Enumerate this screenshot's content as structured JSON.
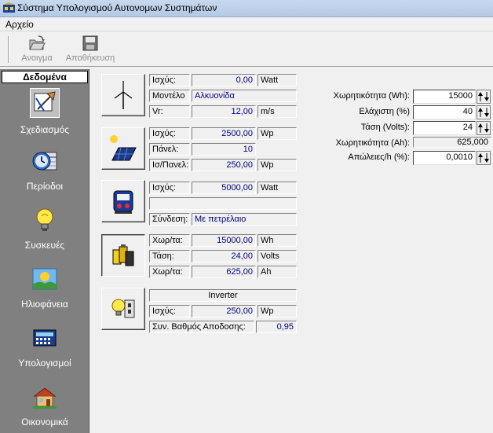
{
  "window": {
    "title": "Σύστημα Υπολογισμού Αυτονομων Συστημάτων"
  },
  "menu": {
    "file": "Αρχείο"
  },
  "toolbar": {
    "open_label": "Ανοιγμα",
    "save_label": "Αποθήκευση"
  },
  "sidebar": {
    "header": "Δεδομένα",
    "items": [
      {
        "label": "Σχεδιασμός",
        "icon": "design-tools-icon"
      },
      {
        "label": "Περίοδοι",
        "icon": "clock-calendar-icon"
      },
      {
        "label": "Συσκευές",
        "icon": "lightbulb-icon"
      },
      {
        "label": "Ηλιοφάνεια",
        "icon": "sunshine-icon"
      },
      {
        "label": "Υπολογισμοί",
        "icon": "calculator-icon"
      },
      {
        "label": "Οικονομικά",
        "icon": "house-icon"
      }
    ]
  },
  "wind": {
    "power_label": "Ισχύς:",
    "power_value": "0,00",
    "power_unit": "Watt",
    "model_label": "Μοντέλο",
    "model_value": "Αλκυονίδα",
    "vr_label": "Vr:",
    "vr_value": "12,00",
    "vr_unit": "m/s"
  },
  "solar": {
    "power_label": "Ισχύς:",
    "power_value": "2500,00",
    "power_unit": "Wp",
    "panels_label": "Πάνελ:",
    "panels_value": "10",
    "per_panel_label": "Ισ/Πανελ:",
    "per_panel_value": "250,00",
    "per_panel_unit": "Wp"
  },
  "generator": {
    "power_label": "Ισχύς:",
    "power_value": "5000,00",
    "power_unit": "Watt",
    "blank": "",
    "connection_label": "Σύνδεση:",
    "connection_value": "Με πετρέλαιο"
  },
  "battery": {
    "cap_label": "Χωρ/τα:",
    "cap_value": "15000,00",
    "cap_unit": "Wh",
    "voltage_label": "Τάση:",
    "voltage_value": "24,00",
    "voltage_unit": "Volts",
    "cap_ah_label": "Χωρ/τα:",
    "cap_ah_value": "625,00",
    "cap_ah_unit": "Ah"
  },
  "inverter": {
    "title": "Inverter",
    "power_label": "Ισχύς:",
    "power_value": "250,00",
    "power_unit": "Wp",
    "efficiency_label": "Συν. Βαθμός Αποδοσης:",
    "efficiency_value": "0,95"
  },
  "settings": {
    "capacity_wh_label": "Χωρητικότητα (Wh):",
    "capacity_wh_value": "15000",
    "min_label": "Ελάχιστη (%)",
    "min_value": "40",
    "voltage_label": "Τάση (Volts):",
    "voltage_value": "24",
    "capacity_ah_label": "Χωρητικότητα (Ah):",
    "capacity_ah_value": "625,000",
    "losses_label": "Απώλειες/h (%):",
    "losses_value": "0,0010"
  }
}
